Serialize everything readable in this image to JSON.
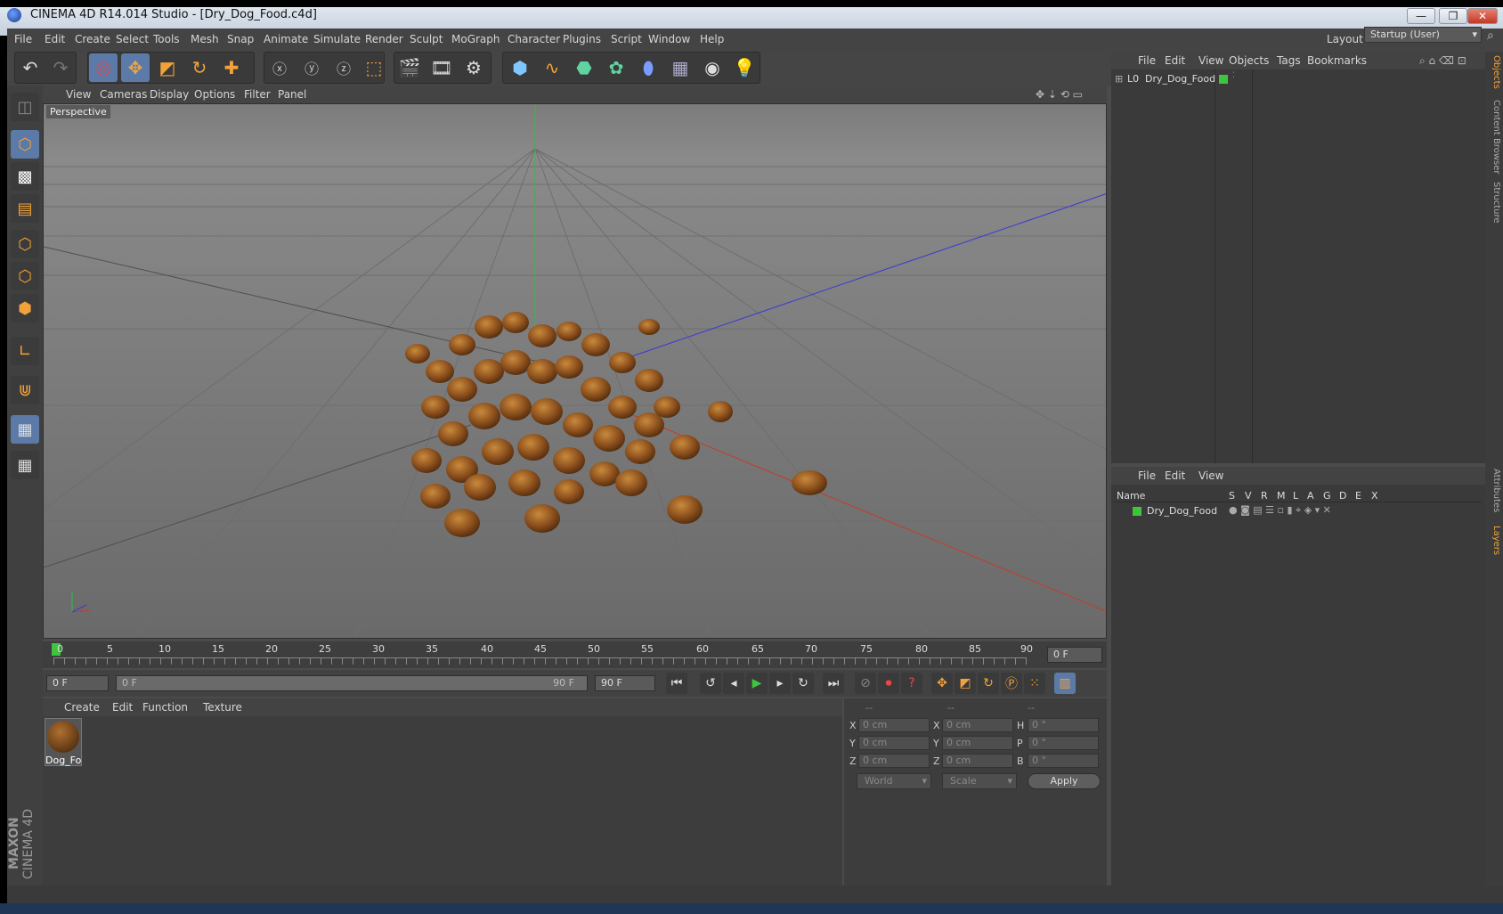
{
  "window": {
    "title": "CINEMA 4D R14.014 Studio - [Dry_Dog_Food.c4d]",
    "controls": [
      "—",
      "❐",
      "✕"
    ]
  },
  "menubar": {
    "items": [
      "File",
      "Edit",
      "Create",
      "Select",
      "Tools",
      "Mesh",
      "Snap",
      "Animate",
      "Simulate",
      "Render",
      "Sculpt",
      "MoGraph",
      "Character",
      "Plugins",
      "Script",
      "Window",
      "Help"
    ],
    "layout_label": "Layout:",
    "layout_value": "Startup (User)"
  },
  "viewport": {
    "menu": [
      "View",
      "Cameras",
      "Display",
      "Options",
      "Filter",
      "Panel"
    ],
    "label": "Perspective"
  },
  "timeline": {
    "ticks": [
      "0",
      "5",
      "10",
      "15",
      "20",
      "25",
      "30",
      "35",
      "40",
      "45",
      "50",
      "55",
      "60",
      "65",
      "70",
      "75",
      "80",
      "85",
      "90"
    ],
    "current_frame": "0 F",
    "start_frame": "0 F",
    "range_start": "0 F",
    "range_end": "90 F",
    "end_frame": "90 F"
  },
  "material_manager": {
    "menu": [
      "Create",
      "Edit",
      "Function",
      "Texture"
    ],
    "materials": [
      {
        "name": "Dog_Fo"
      }
    ]
  },
  "coordinates": {
    "headers": [
      "--",
      "--",
      "--"
    ],
    "rows": [
      {
        "a": "X",
        "av": "0 cm",
        "b": "X",
        "bv": "0 cm",
        "c": "H",
        "cv": "0 °"
      },
      {
        "a": "Y",
        "av": "0 cm",
        "b": "Y",
        "bv": "0 cm",
        "c": "P",
        "cv": "0 °"
      },
      {
        "a": "Z",
        "av": "0 cm",
        "b": "Z",
        "bv": "0 cm",
        "c": "B",
        "cv": "0 °"
      }
    ],
    "mode": "World",
    "scale": "Scale",
    "apply": "Apply"
  },
  "object_manager": {
    "menu": [
      "File",
      "Edit",
      "View",
      "Objects",
      "Tags",
      "Bookmarks"
    ],
    "objects": [
      {
        "name": "Dry_Dog_Food",
        "color": "#3ec43e"
      }
    ]
  },
  "layer_manager": {
    "menu": [
      "File",
      "Edit",
      "View"
    ],
    "columns": [
      "Name",
      "S",
      "V",
      "R",
      "M",
      "L",
      "A",
      "G",
      "D",
      "E",
      "X"
    ],
    "layers": [
      {
        "name": "Dry_Dog_Food",
        "color": "#3ec43e"
      }
    ]
  },
  "side_tabs": [
    "Objects",
    "Content Browser",
    "Structure",
    "Attributes",
    "Layers"
  ],
  "brand": {
    "maxon": "MAXON",
    "product": "CINEMA 4D"
  },
  "colors": {
    "accent": "#f2a23a",
    "active_tool": "#5c7aa8",
    "axis_x": "#c0392b",
    "axis_y": "#27ae60",
    "axis_z": "#2c3ec0"
  }
}
